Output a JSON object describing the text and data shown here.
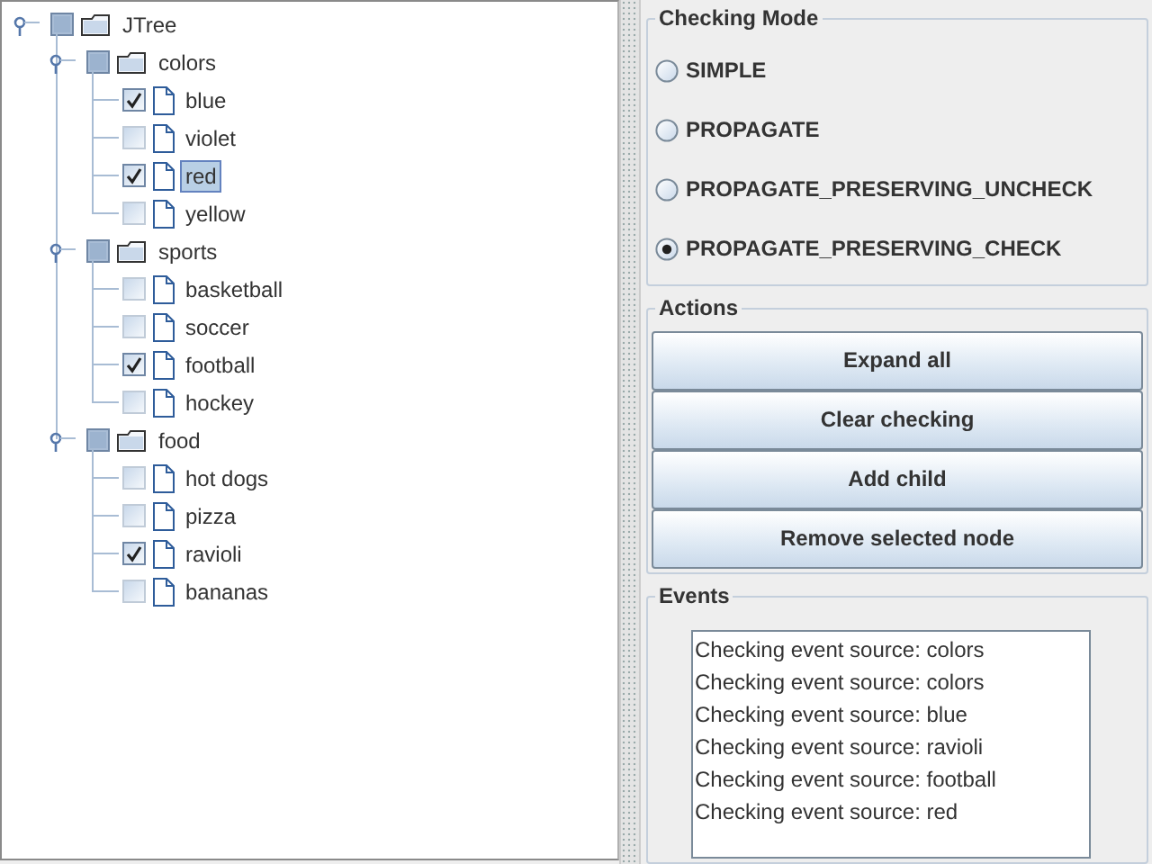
{
  "tree": {
    "label": "JTree",
    "kind": "folder",
    "checked": false,
    "partial": true,
    "expanded": true,
    "selected": false,
    "children": [
      {
        "label": "colors",
        "kind": "folder",
        "checked": false,
        "partial": true,
        "expanded": true,
        "selected": false,
        "children": [
          {
            "label": "blue",
            "kind": "leaf",
            "checked": true,
            "selected": false
          },
          {
            "label": "violet",
            "kind": "leaf",
            "checked": false,
            "selected": false
          },
          {
            "label": "red",
            "kind": "leaf",
            "checked": true,
            "selected": true
          },
          {
            "label": "yellow",
            "kind": "leaf",
            "checked": false,
            "selected": false
          }
        ]
      },
      {
        "label": "sports",
        "kind": "folder",
        "checked": false,
        "partial": true,
        "expanded": true,
        "selected": false,
        "children": [
          {
            "label": "basketball",
            "kind": "leaf",
            "checked": false,
            "selected": false
          },
          {
            "label": "soccer",
            "kind": "leaf",
            "checked": false,
            "selected": false
          },
          {
            "label": "football",
            "kind": "leaf",
            "checked": true,
            "selected": false
          },
          {
            "label": "hockey",
            "kind": "leaf",
            "checked": false,
            "selected": false
          }
        ]
      },
      {
        "label": "food",
        "kind": "folder",
        "checked": false,
        "partial": true,
        "expanded": true,
        "selected": false,
        "children": [
          {
            "label": "hot dogs",
            "kind": "leaf",
            "checked": false,
            "selected": false
          },
          {
            "label": "pizza",
            "kind": "leaf",
            "checked": false,
            "selected": false
          },
          {
            "label": "ravioli",
            "kind": "leaf",
            "checked": true,
            "selected": false
          },
          {
            "label": "bananas",
            "kind": "leaf",
            "checked": false,
            "selected": false
          }
        ]
      }
    ]
  },
  "checking_mode": {
    "title": "Checking Mode",
    "options": [
      {
        "label": "SIMPLE",
        "selected": false
      },
      {
        "label": "PROPAGATE",
        "selected": false
      },
      {
        "label": "PROPAGATE_PRESERVING_UNCHECK",
        "selected": false
      },
      {
        "label": "PROPAGATE_PRESERVING_CHECK",
        "selected": true
      }
    ]
  },
  "actions": {
    "title": "Actions",
    "buttons": [
      "Expand all",
      "Clear checking",
      "Add child",
      "Remove selected node"
    ]
  },
  "events": {
    "title": "Events",
    "lines": [
      "Checking event source: colors",
      "Checking event source: colors",
      "Checking event source: blue",
      "Checking event source: ravioli",
      "Checking event source: football",
      "Checking event source: red"
    ]
  }
}
